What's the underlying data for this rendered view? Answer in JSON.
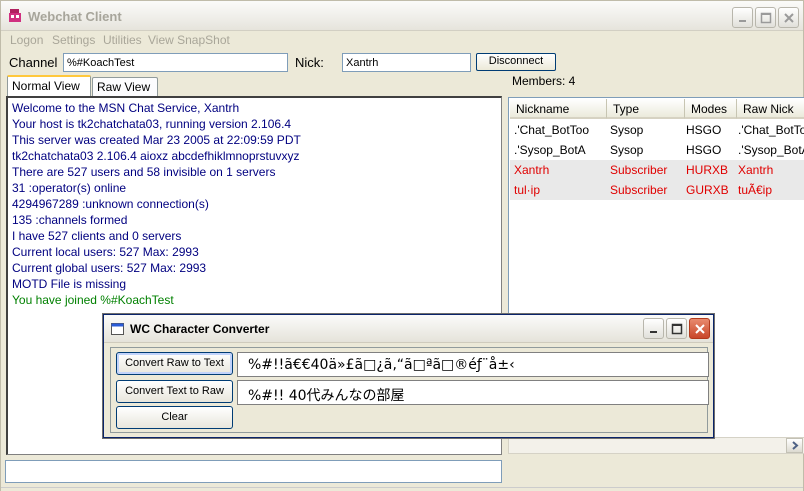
{
  "window": {
    "title": "Webchat Client"
  },
  "menu": [
    "Logon",
    "Settings",
    "Utilities",
    "View SnapShot"
  ],
  "toolbar": {
    "channel_label": "Channel",
    "channel_value": "%#KoachTest",
    "nick_label": "Nick:",
    "nick_value": "Xantrh",
    "disconnect_label": "Disconnect"
  },
  "tabs": [
    "Normal View",
    "Raw View"
  ],
  "chat_lines": [
    {
      "text": "Welcome to the MSN Chat Service, Xantrh",
      "color": "blue"
    },
    {
      "text": "Your host is tk2chatchata03, running version 2.106.4",
      "color": "blue"
    },
    {
      "text": "This server was created Mar 23 2005 at 22:09:59 PDT",
      "color": "blue"
    },
    {
      "text": "tk2chatchata03 2.106.4 aioxz abcdefhiklmnoprstuvxyz",
      "color": "blue"
    },
    {
      "text": "There are 527 users and 58 invisible on 1 servers",
      "color": "blue"
    },
    {
      "text": "31 :operator(s) online",
      "color": "blue"
    },
    {
      "text": "4294967289 :unknown connection(s)",
      "color": "blue"
    },
    {
      "text": "135 :channels formed",
      "color": "blue"
    },
    {
      "text": "I have 527 clients and 0 servers",
      "color": "blue"
    },
    {
      "text": "Current local users: 527 Max: 2993",
      "color": "blue"
    },
    {
      "text": "Current global users: 527 Max: 2993",
      "color": "blue"
    },
    {
      "text": "MOTD File is missing",
      "color": "blue"
    },
    {
      "text": "You have joined %#KoachTest",
      "color": "green"
    }
  ],
  "members": {
    "label": "Members: 4",
    "columns": [
      "Nickname",
      "Type",
      "Modes",
      "Raw Nick"
    ],
    "rows": [
      {
        "nickname": ".'Chat_BotToo",
        "type": "Sysop",
        "modes": "HSGO",
        "raw": ".'Chat_BotToo",
        "color": "#000000"
      },
      {
        "nickname": ".'Sysop_BotA",
        "type": "Sysop",
        "modes": "HSGO",
        "raw": ".'Sysop_BotA",
        "color": "#000000"
      },
      {
        "nickname": "Xantrh",
        "type": "Subscriber",
        "modes": "HURXB",
        "raw": "Xantrh",
        "color": "#e00000"
      },
      {
        "nickname": "tul·ip",
        "type": "Subscriber",
        "modes": "GURXB",
        "raw": "tuÃ€ip",
        "color": "#e00000"
      }
    ]
  },
  "dialog": {
    "title": "WC Character Converter",
    "convert_raw_label": "Convert Raw to Text",
    "convert_text_label": "Convert Text to Raw",
    "clear_label": "Clear",
    "raw_value": "%#!!ã€€40ä»£ã□¿ã‚“ã□ªã□®éƒ¨å±‹",
    "text_value": "%#!!  40代みんなの部屋"
  },
  "colors": {
    "chat_blue": "#000080",
    "chat_green": "#008000",
    "member_red": "#e00000"
  }
}
